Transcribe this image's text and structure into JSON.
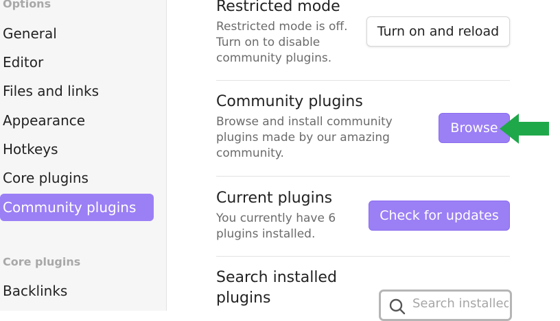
{
  "sidebar": {
    "options_heading": "Options",
    "items": [
      {
        "label": "General"
      },
      {
        "label": "Editor"
      },
      {
        "label": "Files and links"
      },
      {
        "label": "Appearance"
      },
      {
        "label": "Hotkeys"
      },
      {
        "label": "Core plugins"
      },
      {
        "label": "Community plugins",
        "active": true
      }
    ],
    "core_heading": "Core plugins",
    "core_items": [
      {
        "label": "Backlinks"
      }
    ]
  },
  "settings": {
    "restricted": {
      "title": "Restricted mode",
      "description": "Restricted mode is off. Turn on to disable community plugins.",
      "button": "Turn on and reload"
    },
    "community": {
      "title": "Community plugins",
      "description": "Browse and install community plugins made by our amazing community.",
      "button": "Browse"
    },
    "current": {
      "title": "Current plugins",
      "description": "You currently have 6 plugins installed.",
      "button": "Check for updates"
    },
    "search": {
      "title": "Search installed plugins",
      "placeholder": "Search installed plugins..."
    }
  },
  "colors": {
    "accent": "#9b7ff5",
    "arrow": "#1fa84a"
  },
  "icons": [
    "search-icon",
    "arrow-left-icon"
  ]
}
